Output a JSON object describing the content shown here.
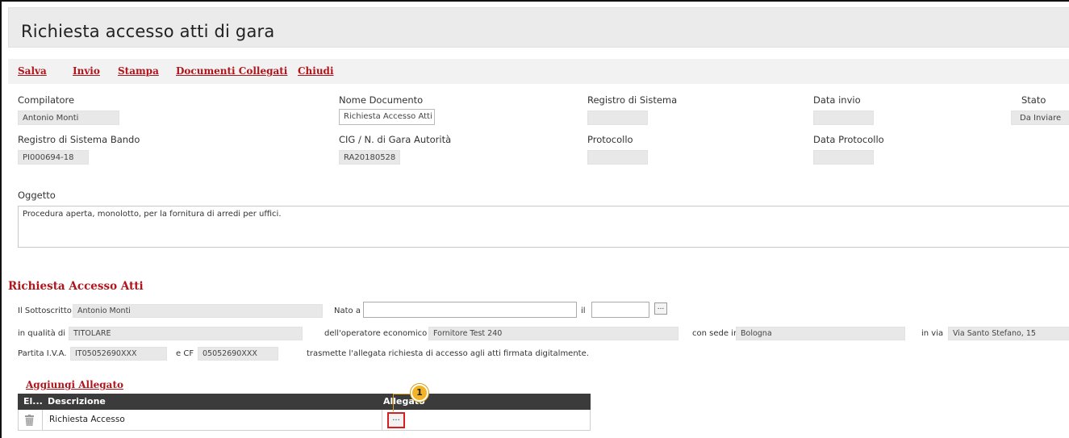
{
  "window": {
    "title": "Richiesta accesso atti di gara"
  },
  "toolbar": {
    "salva": "Salva",
    "invio": "Invio",
    "stampa": "Stampa",
    "documenti_collegati": "Documenti Collegati",
    "chiudi": "Chiudi"
  },
  "header_fields": {
    "compilatore_label": "Compilatore",
    "compilatore_value": "Antonio Monti",
    "nome_documento_label": "Nome Documento",
    "nome_documento_value": "Richiesta Accesso Atti",
    "registro_sistema_label": "Registro di Sistema",
    "registro_sistema_value": "",
    "data_invio_label": "Data invio",
    "data_invio_value": "",
    "stato_label": "Stato",
    "stato_value": "Da Inviare",
    "registro_bando_label": "Registro di Sistema Bando",
    "registro_bando_value": "PI000694-18",
    "cig_label": "CIG / N. di Gara Autorità",
    "cig_value": "RA20180528",
    "protocollo_label": "Protocollo",
    "protocollo_value": "",
    "data_protocollo_label": "Data Protocollo",
    "data_protocollo_value": ""
  },
  "oggetto": {
    "label": "Oggetto",
    "value": "Procedura aperta, monolotto, per la fornitura di arredi per uffici."
  },
  "section": {
    "title": "Richiesta Accesso Atti",
    "sottoscritto_label": "Il Sottoscritto",
    "sottoscritto_value": "Antonio Monti",
    "nato_a_label": "Nato a",
    "nato_a_value": "",
    "il_label": "il",
    "il_value": "",
    "dots": "...",
    "qualita_label": "in qualità di",
    "qualita_value": "TITOLARE",
    "operatore_label": "dell'operatore economico",
    "operatore_value": "Fornitore Test 240",
    "sede_label": "con sede in",
    "sede_value": "Bologna",
    "via_label": "in via",
    "via_value": "Via Santo Stefano, 15",
    "piva_label": "Partita I.V.A.",
    "piva_value": "IT05052690XXX",
    "cf_label": "e CF",
    "cf_value": "05052690XXX",
    "trasmette_text": "trasmette l'allegata richiesta di accesso agli atti firmata digitalmente."
  },
  "allegati": {
    "add_link": "Aggiungi Allegato",
    "columns": [
      "El...",
      "Descrizione",
      "Allegato"
    ],
    "rows": [
      {
        "descrizione": "Richiesta Accesso",
        "allegato_button": "..."
      }
    ]
  },
  "callout": {
    "number": "1",
    "color": "#f2b426",
    "highlight_color": "#d81e1e"
  },
  "colors": {
    "accent": "#b0151c",
    "header_bg": "#3b3b3b"
  }
}
